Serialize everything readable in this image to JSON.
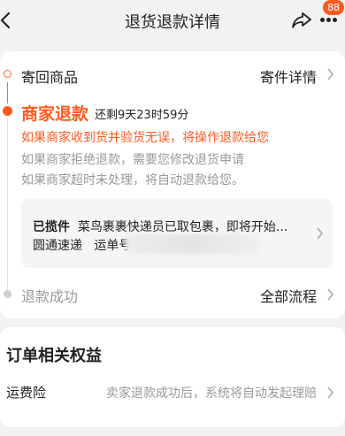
{
  "header": {
    "title": "退货退款详情",
    "badge_count": "88",
    "icons": [
      "back-arrow-icon",
      "share-icon",
      "more-icon"
    ]
  },
  "progress": {
    "step1": {
      "label": "寄回商品",
      "action": "寄件详情"
    },
    "step2": {
      "label": "商家退款",
      "remaining": "还剩9天23时59分",
      "notes": [
        "如果商家收到货并验货无误，将操作退款给您",
        "如果商家拒绝退款，需要您修改退货申请",
        "如果商家超时未处理，将自动退款给您。"
      ]
    },
    "pickup": {
      "status": "已揽件",
      "message": "菜鸟裹裹快递员已取包裹，即将开始...",
      "carrier": "圆通速递",
      "tracking_label": "运单号"
    },
    "step3": {
      "label": "退款成功",
      "action": "全部流程"
    }
  },
  "benefits": {
    "title": "订单相关权益",
    "shipping_insurance": {
      "label": "运费险",
      "desc": "卖家退款成功后，系统将自动发起理赔"
    }
  },
  "colors": {
    "accent": "#ff5a1f",
    "muted": "#999999"
  }
}
